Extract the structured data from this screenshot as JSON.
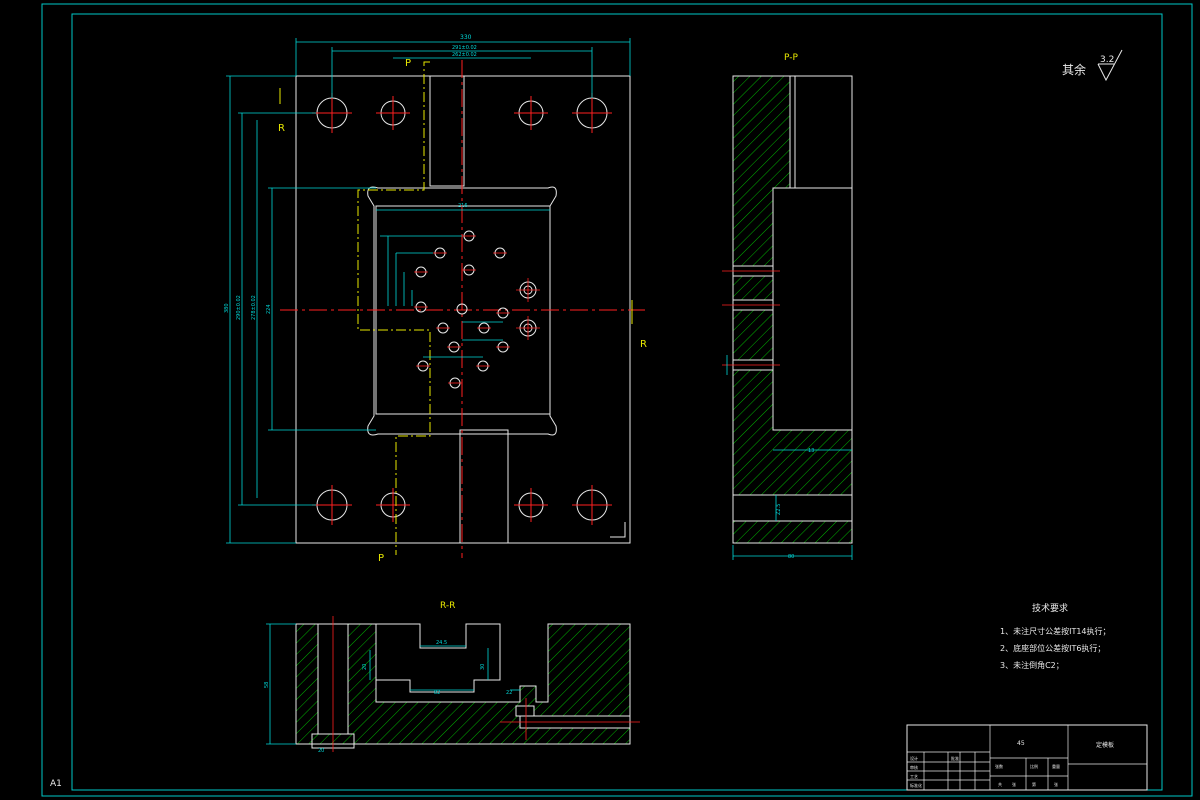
{
  "sheet": {
    "sheet_label": "A1"
  },
  "section_marks": {
    "p_top": "P",
    "p_bottom": "P",
    "r_left": "R",
    "r_right": "R"
  },
  "views": {
    "pp_title": "P-P",
    "rr_title": "R-R"
  },
  "roughness": {
    "prefix": "其余",
    "value": "3.2"
  },
  "dimensions": {
    "plan_overall_width": "330",
    "plan_width_2": "291±0.02",
    "plan_width_3": "262±0.02",
    "plan_overall_height": "380",
    "plan_height_2": "290±0.02",
    "plan_height_3": "278±0.02",
    "plan_height_4": "224",
    "cavity_width": "216",
    "pp_width": "80",
    "pp_thickness": "13",
    "pp_bottom": "Z2.5",
    "rr_height": "58",
    "rr_dim_1": "24.5",
    "rr_dim_2": "30",
    "rr_dim_3": "20",
    "rr_dim_4": "82",
    "rr_dim_5": "22",
    "rr_dim_6": "20"
  },
  "tech_requirements": {
    "title": "技术要求",
    "items": [
      "1、未注尺寸公差按IT14执行；",
      "2、底座部位公差按IT6执行；",
      "3、未注倒角C2；"
    ]
  },
  "title_block": {
    "material": "45",
    "part_name": "定模板",
    "cells": [
      "设计",
      "审核",
      "工艺",
      "标准化",
      "批准",
      "比例",
      "重量",
      "张数",
      "共",
      "张",
      "第",
      "张"
    ]
  },
  "colors": {
    "frame": "#00c8c8",
    "outline": "#e8e8e8",
    "centerline": "#ff2020",
    "hidden": "#e8e800",
    "hatch": "#00b400",
    "dimension": "#00d8d8"
  }
}
